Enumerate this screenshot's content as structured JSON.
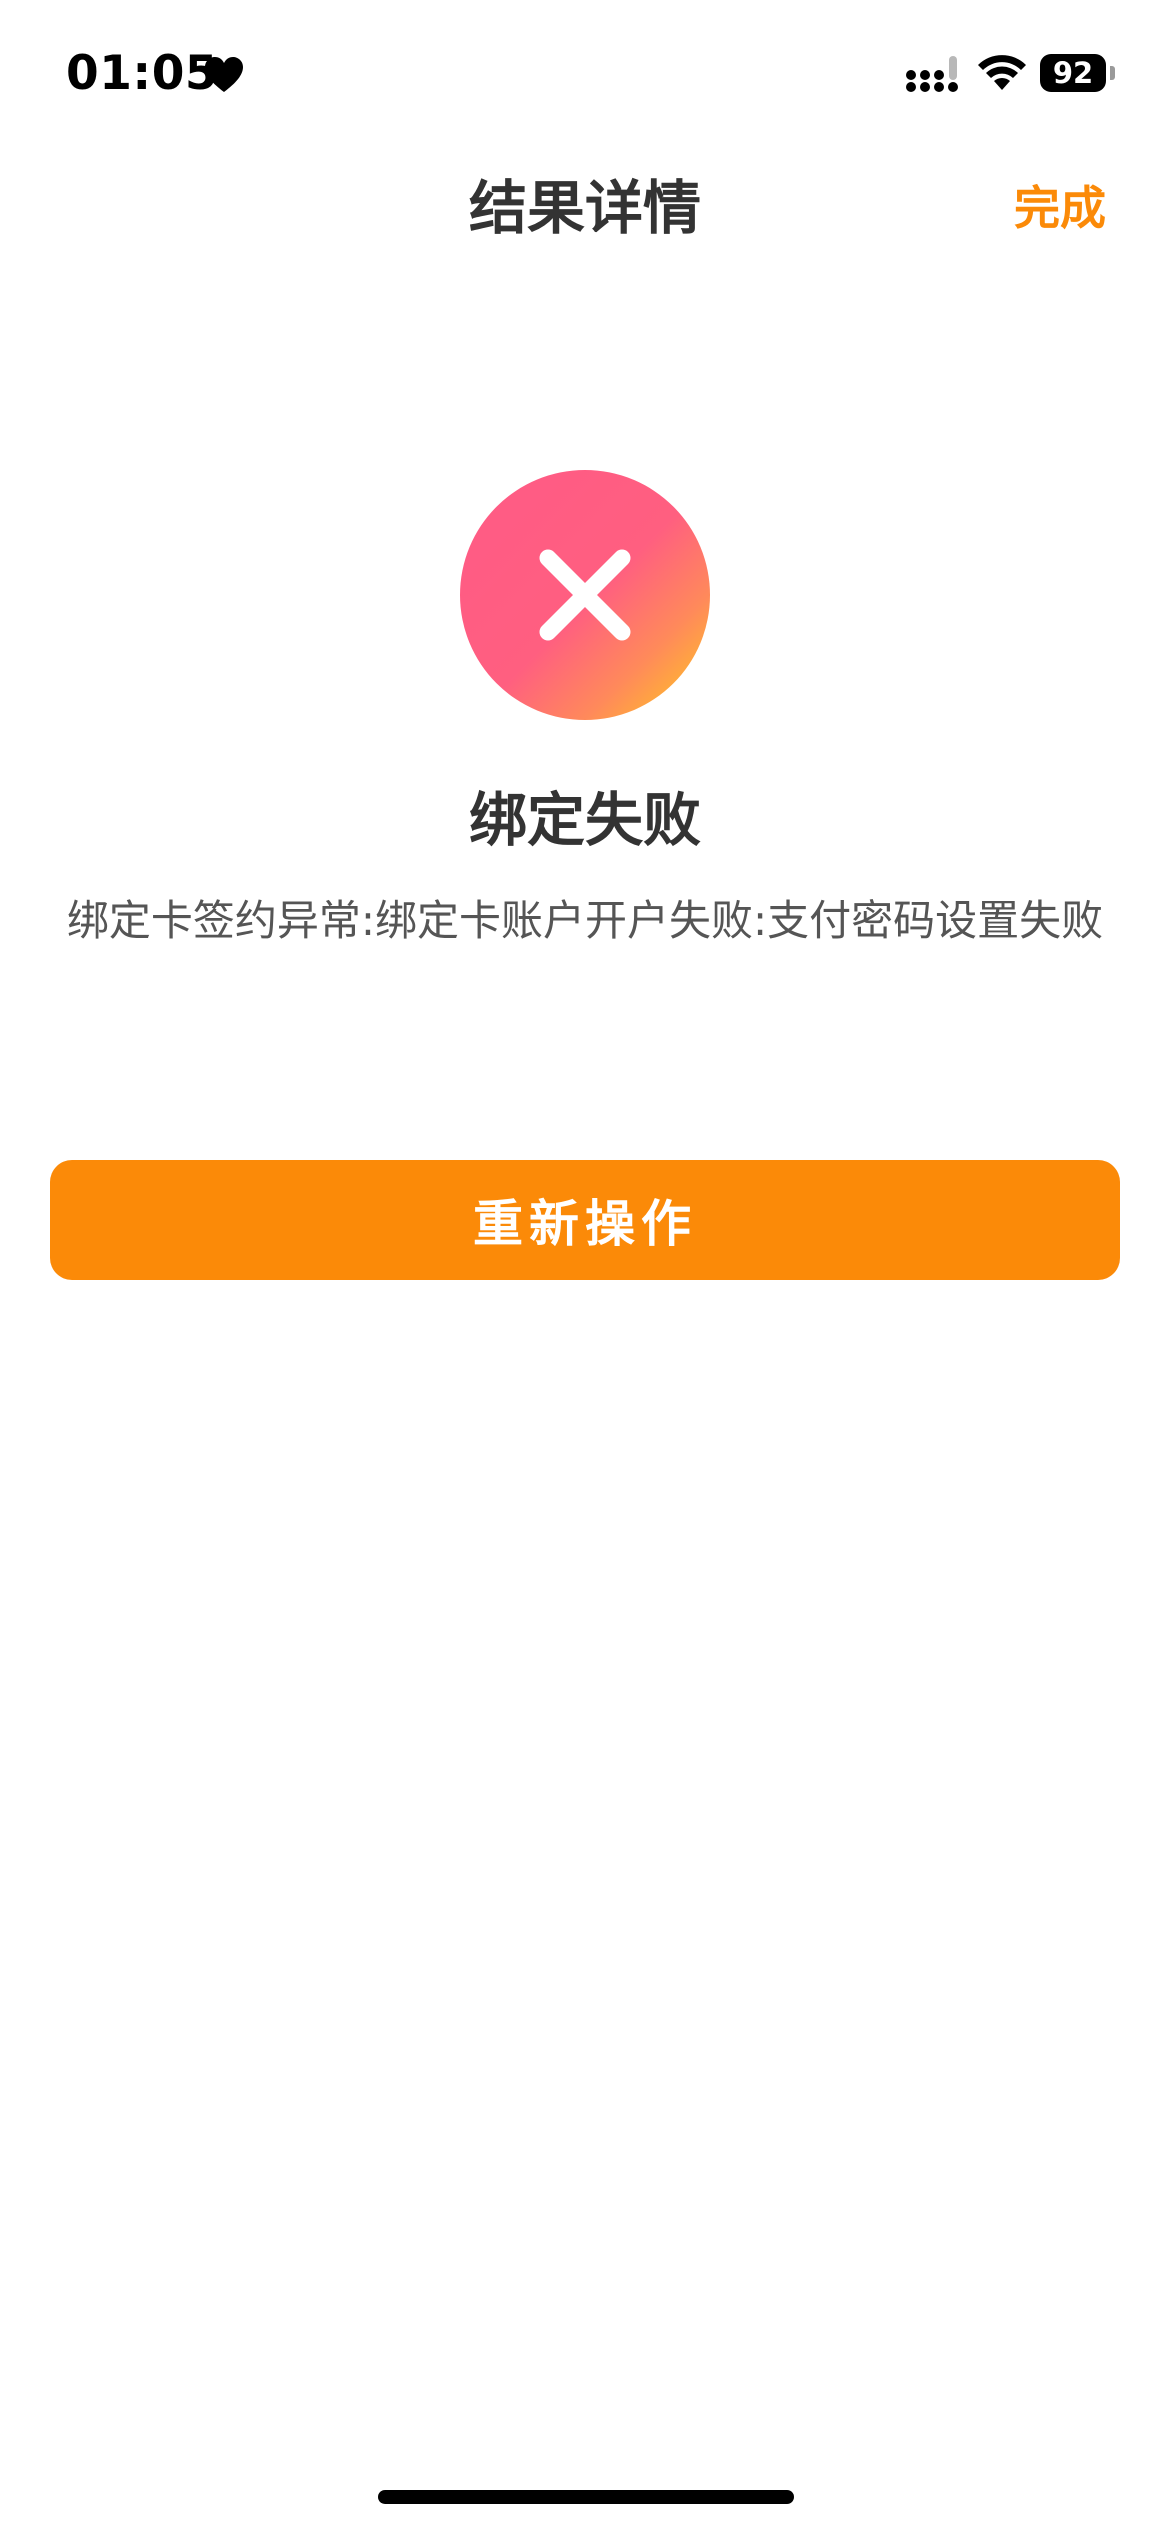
{
  "status_bar": {
    "time": "01:05",
    "battery_level": "92",
    "icons": [
      "heart-icon",
      "signal-icon",
      "wifi-icon",
      "battery-icon"
    ]
  },
  "nav": {
    "title": "结果详情",
    "done_label": "完成"
  },
  "result": {
    "icon": "close-icon",
    "title": "绑定失败",
    "message": "绑定卡签约异常:绑定卡账户开户失败:支付密码设置失败"
  },
  "actions": {
    "retry_label": "重新操作"
  },
  "colors": {
    "accent": "#fb8a08",
    "icon_gradient_start": "#ff5a86",
    "icon_gradient_end": "#ffcf1a",
    "text_primary": "#333333",
    "text_secondary": "#555555"
  }
}
